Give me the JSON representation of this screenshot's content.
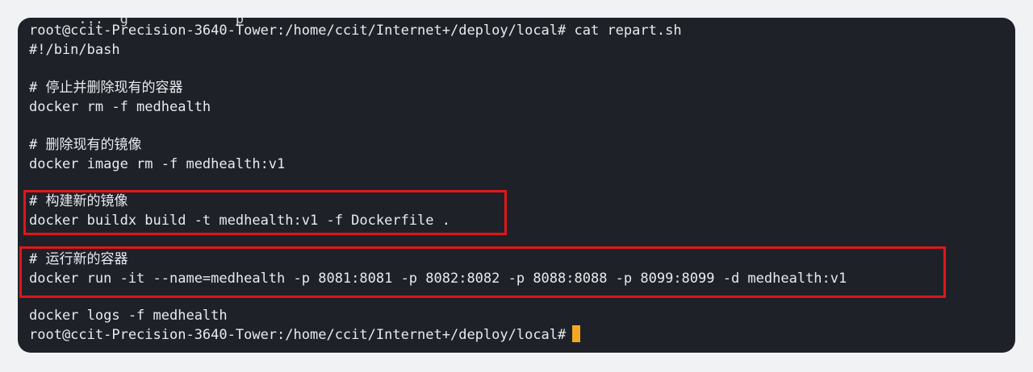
{
  "terminal": {
    "partial_line": "      ...  g             p",
    "lines": [
      "root@ccit-Precision-3640-Tower:/home/ccit/Internet+/deploy/local# cat repart.sh",
      "#!/bin/bash",
      "",
      "# 停止并删除现有的容器",
      "docker rm -f medhealth",
      "",
      "# 删除现有的镜像",
      "docker image rm -f medhealth:v1",
      "",
      "# 构建新的镜像",
      "docker buildx build -t medhealth:v1 -f Dockerfile .",
      "",
      "# 运行新的容器",
      "docker run -it --name=medhealth -p 8081:8081 -p 8082:8082 -p 8088:8088 -p 8099:8099 -d medhealth:v1",
      "",
      "docker logs -f medhealth"
    ],
    "prompt": "root@ccit-Precision-3640-Tower:/home/ccit/Internet+/deploy/local#"
  },
  "colors": {
    "terminal_bg": "#1e2228",
    "text": "#e8eaee",
    "highlight_border": "#e0161b",
    "cursor": "#f5a623"
  }
}
